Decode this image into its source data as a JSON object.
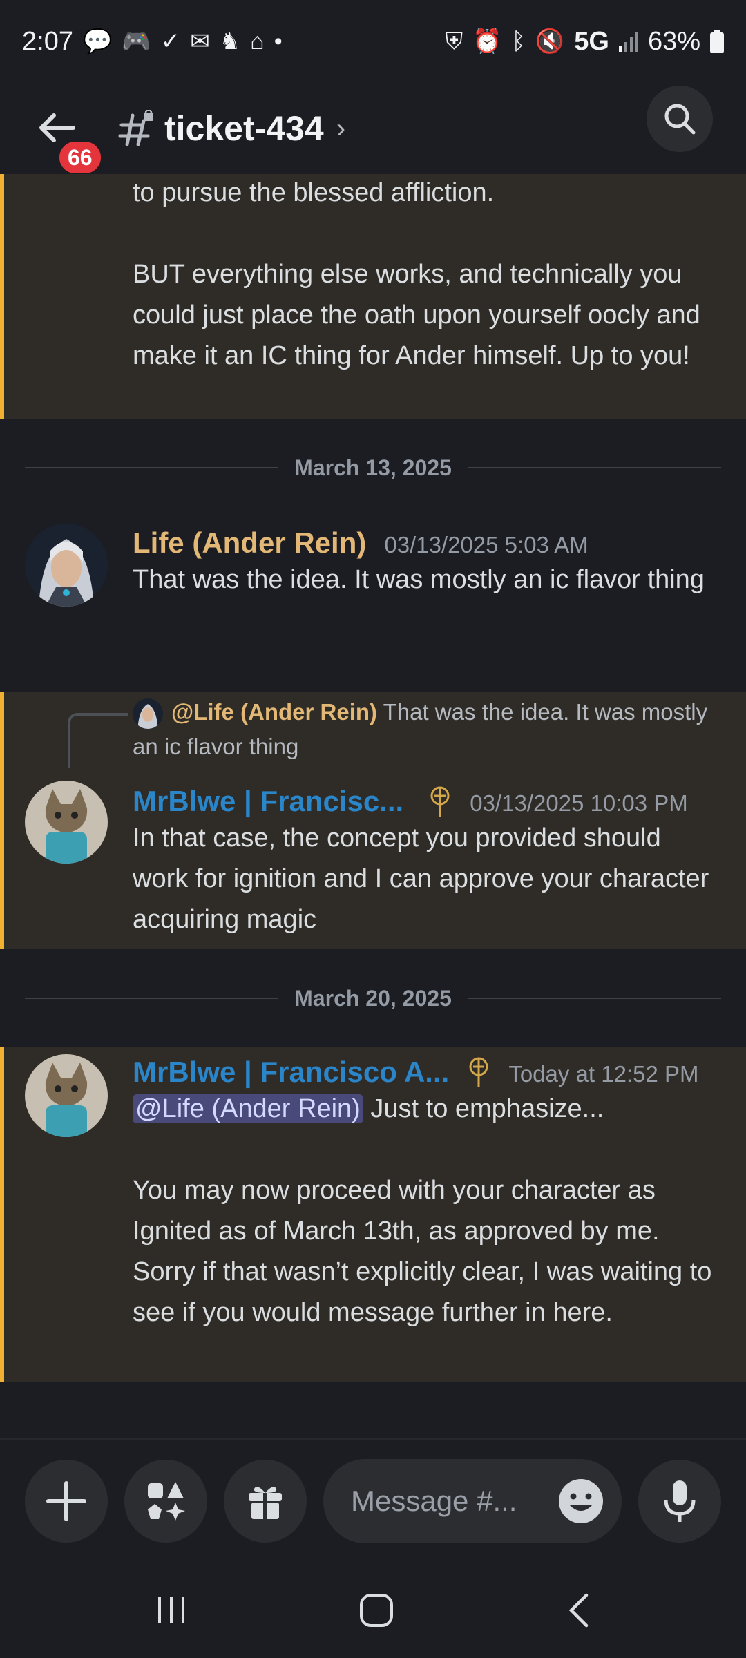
{
  "status": {
    "time": "2:07",
    "network": "5G",
    "battery": "63%"
  },
  "header": {
    "unread_badge": "66",
    "channel_name": "ticket-434",
    "chevron": "›"
  },
  "messages": {
    "continued": {
      "line1": "to pursue the blessed affliction.",
      "para2": "BUT everything else works, and technically you could just place the oath upon yourself oocly and make it an IC thing for Ander himself. Up to you!"
    },
    "divider1": "March 13, 2025",
    "msg1": {
      "author": "Life (Ander Rein)",
      "time": "03/13/2025 5:03 AM",
      "text": "That was the idea. It was mostly an ic flavor thing"
    },
    "msg2": {
      "reply_author": "@Life (Ander Rein)",
      "reply_text": "That was the idea. It was mostly an ic flavor thing",
      "author": "MrBlwe | Francisc...",
      "time": "03/13/2025 10:03 PM",
      "text": "In that case, the concept you provided should work for ignition and I can approve your character acquiring magic"
    },
    "divider2": "March 20, 2025",
    "msg3": {
      "author": "MrBlwe | Francisco A...",
      "time": "Today at 12:52 PM",
      "mention": "@Life (Ander Rein)",
      "text1": "Just to emphasize...",
      "text2": "You may now proceed with your character as Ignited as of March 13th, as approved by me. Sorry if that wasn’t explicitly clear, I was waiting to see if you would message further in here."
    }
  },
  "composer": {
    "placeholder": "Message #..."
  },
  "colors": {
    "highlight_bar": "#f0b132",
    "highlight_bg": "#2f2c27",
    "author_gold": "#e3b876",
    "author_blue": "#2b85c9"
  }
}
